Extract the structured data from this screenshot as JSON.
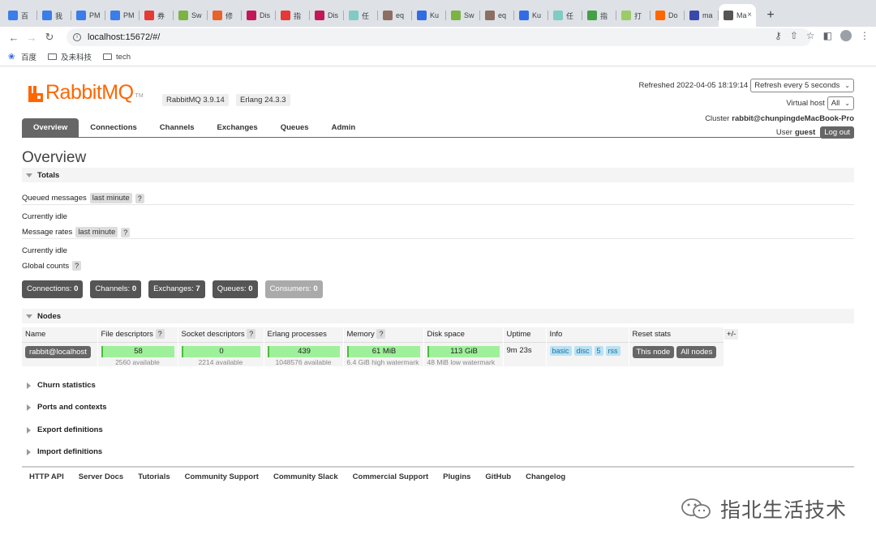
{
  "browser": {
    "tabs": [
      {
        "label": "百",
        "color": "#3b7de9",
        "icon": "browser-tab-favicon"
      },
      {
        "label": "我",
        "color": "#3b7de9",
        "icon": "browser-tab-favicon"
      },
      {
        "label": "PM",
        "color": "#3b7de9",
        "icon": "browser-tab-favicon"
      },
      {
        "label": "PM",
        "color": "#3b7de9",
        "icon": "browser-tab-favicon"
      },
      {
        "label": "券",
        "color": "#e53935",
        "icon": "browser-tab-favicon"
      },
      {
        "label": "Sw",
        "color": "#7cb342",
        "icon": "browser-tab-favicon"
      },
      {
        "label": "修",
        "color": "#e8622c",
        "icon": "browser-tab-favicon"
      },
      {
        "label": "Dis",
        "color": "#c2185b",
        "icon": "browser-tab-favicon"
      },
      {
        "label": "指",
        "color": "#e53935",
        "icon": "browser-tab-favicon"
      },
      {
        "label": "Dis",
        "color": "#c2185b",
        "icon": "browser-tab-favicon"
      },
      {
        "label": "任",
        "color": "#80cbc4",
        "icon": "browser-tab-favicon"
      },
      {
        "label": "eq",
        "color": "#8d6e63",
        "icon": "browser-tab-favicon"
      },
      {
        "label": "Ku",
        "color": "#326ce5",
        "icon": "browser-tab-favicon"
      },
      {
        "label": "Sw",
        "color": "#7cb342",
        "icon": "browser-tab-favicon"
      },
      {
        "label": "eq",
        "color": "#8d6e63",
        "icon": "browser-tab-favicon"
      },
      {
        "label": "Ku",
        "color": "#326ce5",
        "icon": "browser-tab-favicon"
      },
      {
        "label": "任",
        "color": "#80cbc4",
        "icon": "browser-tab-favicon"
      },
      {
        "label": "指",
        "color": "#43a047",
        "icon": "browser-tab-favicon"
      },
      {
        "label": "打",
        "color": "#9ccc65",
        "icon": "browser-tab-favicon"
      },
      {
        "label": "Do",
        "color": "#ff6600",
        "icon": "browser-tab-favicon"
      },
      {
        "label": "ma",
        "color": "#3949ab",
        "icon": "browser-tab-favicon"
      },
      {
        "label": "Ma",
        "color": "#555555",
        "icon": "browser-tab-favicon"
      }
    ],
    "url": "localhost:15672/#/",
    "bookmarks": [
      {
        "label": "百度",
        "icon": "baidu-paw-icon"
      },
      {
        "label": "及未科技",
        "icon": "folder-icon"
      },
      {
        "label": "tech",
        "icon": "folder-icon"
      }
    ]
  },
  "header": {
    "brand_colour": "#ff6600",
    "logo_text": "RabbitMQ",
    "logo_tm": "TM",
    "version_badge": "RabbitMQ 3.9.14",
    "erlang_badge": "Erlang 24.3.3",
    "refreshed_label": "Refreshed 2022-04-05 18:19:14",
    "refresh_select": "Refresh every 5 seconds",
    "vhost_label": "Virtual host",
    "vhost_select": "All",
    "cluster_label": "Cluster",
    "cluster_name": "rabbit@chunpingdeMacBook-Pro",
    "user_label": "User",
    "user_name": "guest",
    "logout_label": "Log out"
  },
  "nav": {
    "tabs": [
      "Overview",
      "Connections",
      "Channels",
      "Exchanges",
      "Queues",
      "Admin"
    ],
    "active": "Overview"
  },
  "overview": {
    "title": "Overview",
    "totals_heading": "Totals",
    "queued_label": "Queued messages",
    "queued_range": "last minute",
    "help": "?",
    "idle_1": "Currently idle",
    "rates_label": "Message rates",
    "rates_range": "last minute",
    "idle_2": "Currently idle",
    "global_label": "Global counts",
    "counts": [
      {
        "label": "Connections:",
        "value": "0"
      },
      {
        "label": "Channels:",
        "value": "0"
      },
      {
        "label": "Exchanges:",
        "value": "7"
      },
      {
        "label": "Queues:",
        "value": "0"
      },
      {
        "label": "Consumers:",
        "value": "0"
      }
    ]
  },
  "nodes": {
    "heading": "Nodes",
    "columns": [
      "Name",
      "File descriptors",
      "Socket descriptors",
      "Erlang processes",
      "Memory",
      "Disk space",
      "Uptime",
      "Info",
      "Reset stats"
    ],
    "columns_help": [
      false,
      true,
      true,
      false,
      true,
      false,
      false,
      false,
      false
    ],
    "plus_minus": "+/-",
    "row": {
      "name": "rabbit@localhost",
      "fd_used": "58",
      "fd_avail": "2560 available",
      "sockets_used": "0",
      "sockets_avail": "2214 available",
      "procs_used": "439",
      "procs_avail": "1048576 available",
      "memory_used": "61 MiB",
      "memory_watermark": "6.4 GiB high watermark",
      "disk_used": "113 GiB",
      "disk_watermark": "48 MiB low watermark",
      "uptime": "9m 23s",
      "info_tags": [
        "basic",
        "disc",
        "5",
        "rss"
      ],
      "reset_this": "This node",
      "reset_all": "All nodes"
    },
    "bar_colour": "#9ff09a"
  },
  "collapsed_sections": [
    "Churn statistics",
    "Ports and contexts",
    "Export definitions",
    "Import definitions"
  ],
  "footer": {
    "links": [
      "HTTP API",
      "Server Docs",
      "Tutorials",
      "Community Support",
      "Community Slack",
      "Commercial Support",
      "Plugins",
      "GitHub",
      "Changelog"
    ]
  },
  "watermark": {
    "text": "指北生活技术"
  }
}
